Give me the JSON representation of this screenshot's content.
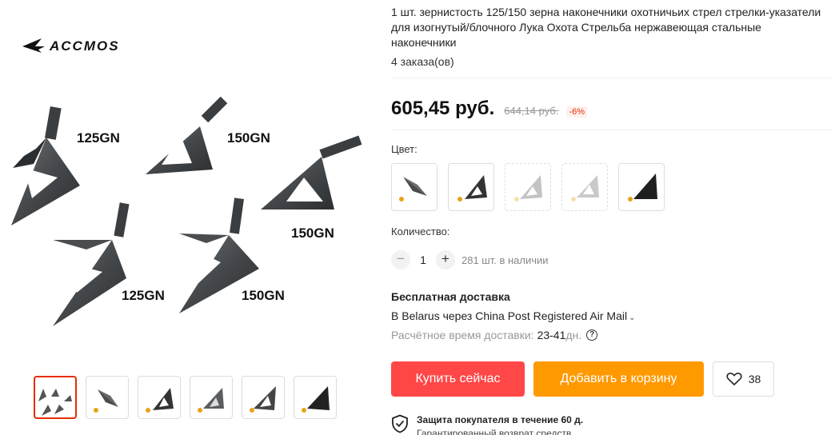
{
  "product": {
    "title": "1 шт. зернистость 125/150 зерна наконечники охотничьих стрел стрелки-указатели для изогнутый/блочного Лука Охота Стрельба нержавеющая стальные наконечники",
    "orders": "4 заказа(ов)"
  },
  "gallery": {
    "logo_text": "ACCMOS",
    "image_labels": [
      "125GN",
      "150GN",
      "150GN",
      "125GN",
      "150GN"
    ],
    "thumbnails": [
      "thumb-1",
      "thumb-2",
      "thumb-3",
      "thumb-4",
      "thumb-5",
      "thumb-6"
    ],
    "active_thumbnail": 0
  },
  "price": {
    "current": "605,45 руб.",
    "old": "644,14 руб.",
    "discount": "-6%"
  },
  "color": {
    "label": "Цвет:",
    "options": [
      "option-1",
      "option-2",
      "option-3",
      "option-4",
      "option-5"
    ]
  },
  "quantity": {
    "label": "Количество:",
    "minus": "−",
    "value": "1",
    "plus": "+",
    "stock": "281 шт. в наличии"
  },
  "shipping": {
    "title": "Бесплатная доставка",
    "line": "В Belarus через China Post Registered Air Mail",
    "eta_label": "Расчётное время доставки:",
    "eta_value": "23-41",
    "eta_unit": "дн."
  },
  "actions": {
    "buy_now": "Купить сейчас",
    "add_to_cart": "Добавить в корзину",
    "wishlist_count": "38"
  },
  "protection": {
    "title": "Защита покупателя в течение 60 д.",
    "subtitle": "Гарантированный возврат средств"
  },
  "colors": {
    "buy": "#ff4747",
    "cart": "#ff9900",
    "accent": "#e62e04",
    "blade": "#55595c"
  }
}
